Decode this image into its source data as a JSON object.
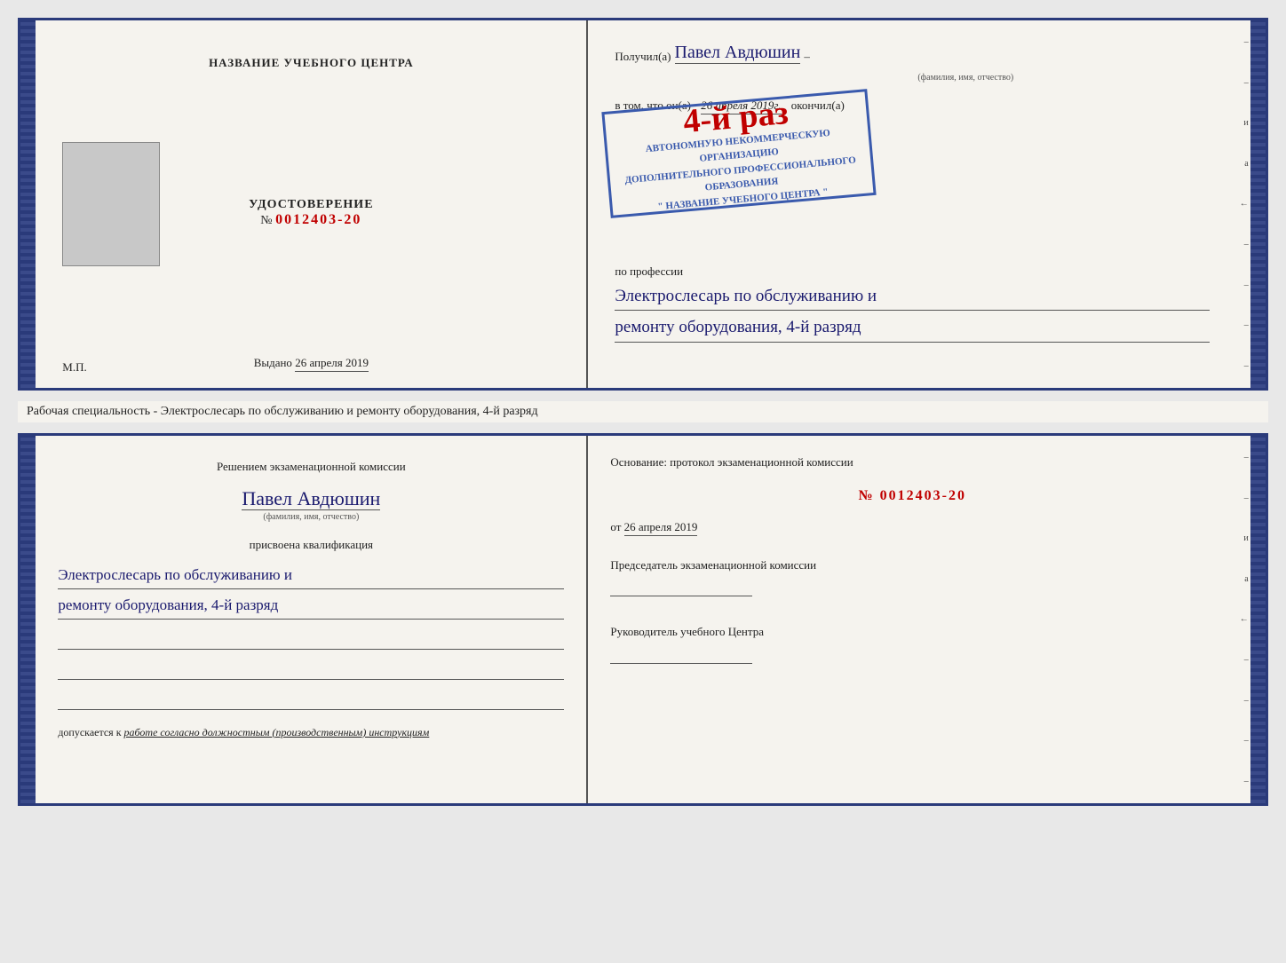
{
  "top_doc": {
    "left": {
      "center_title": "НАЗВАНИЕ УЧЕБНОГО ЦЕНТРА",
      "cert_title": "УДОСТОВЕРЕНИЕ",
      "cert_number_prefix": "№",
      "cert_number": "0012403-20",
      "issued_label": "Выдано",
      "issued_date": "26 апреля 2019",
      "mp_label": "М.П."
    },
    "right": {
      "received_prefix": "Получил(а)",
      "recipient_name": "Павел Авдюшин",
      "fio_subtitle": "(фамилия, имя, отчество)",
      "vtom_prefix": "в том, что он(а)",
      "vtom_date": "26 апреля 2019г.",
      "okончил_label": "окончил(а)",
      "stamp_line1": "4-й раз",
      "stamp_line2": "АВТОНОМНУЮ НЕКОММЕРЧЕСКУЮ ОРГАНИЗАЦИЮ",
      "stamp_line3": "ДОПОЛНИТЕЛЬНОГО ПРОФЕССИОНАЛЬНОГО ОБРАЗОВАНИЯ",
      "stamp_line4": "\" НАЗВАНИЕ УЧЕБНОГО ЦЕНТРА \"",
      "profession_prefix": "по профессии",
      "profession_line1": "Электрослесарь по обслуживанию и",
      "profession_line2": "ремонту оборудования, 4-й разряд"
    }
  },
  "middle": {
    "text": "Рабочая специальность - Электрослесарь по обслуживанию и ремонту оборудования, 4-й разряд"
  },
  "bottom_doc": {
    "left": {
      "decision_title": "Решением экзаменационной комиссии",
      "person_name": "Павел Авдюшин",
      "fio_subtitle": "(фамилия, имя, отчество)",
      "qualification_prefix": "присвоена квалификация",
      "qualification_line1": "Электрослесарь по обслуживанию и",
      "qualification_line2": "ремонту оборудования, 4-й разряд",
      "допускается_prefix": "допускается к",
      "допускается_text": "работе согласно должностным (производственным) инструкциям"
    },
    "right": {
      "osnov_title": "Основание: протокол экзаменационной комиссии",
      "protocol_number": "№  0012403-20",
      "date_prefix": "от",
      "protocol_date": "26 апреля 2019",
      "chairman_title": "Председатель экзаменационной комиссии",
      "head_title": "Руководитель учебного Центра"
    }
  },
  "side_chars": [
    "и",
    "а",
    "←",
    "–",
    "–",
    "–",
    "–"
  ],
  "side_chars2": [
    "и",
    "а",
    "←",
    "–",
    "–",
    "–",
    "–"
  ]
}
